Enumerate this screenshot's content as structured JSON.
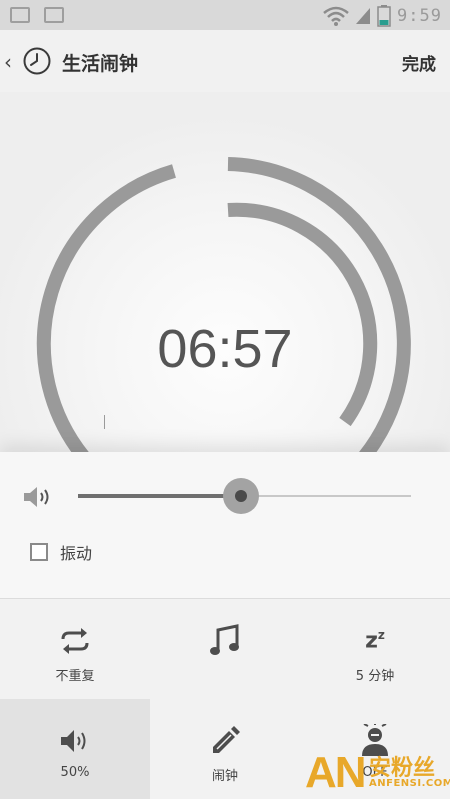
{
  "status_bar": {
    "time": "9:59"
  },
  "header": {
    "back_icon": "chevron-left",
    "clock_icon": "clock",
    "title": "生活闹钟",
    "done_label": "完成"
  },
  "dial": {
    "time": "06:57"
  },
  "volume": {
    "level": 0.49
  },
  "vibrate": {
    "label": "振动",
    "checked": false
  },
  "options": [
    {
      "icon": "repeat",
      "label": "不重复"
    },
    {
      "icon": "music-note",
      "label": ""
    },
    {
      "icon": "snooze-zz",
      "label": "5 分钟"
    },
    {
      "icon": "speaker",
      "label": "50%",
      "active": true
    },
    {
      "icon": "pencil",
      "label": "闹钟"
    },
    {
      "icon": "person",
      "label": "OFF"
    }
  ],
  "watermark": {
    "logo": "AN",
    "cn": "安粉丝",
    "en": "ANFENSI.COM"
  },
  "colors": {
    "accent": "#9e9e9e",
    "watermark": "#e8a82a"
  }
}
